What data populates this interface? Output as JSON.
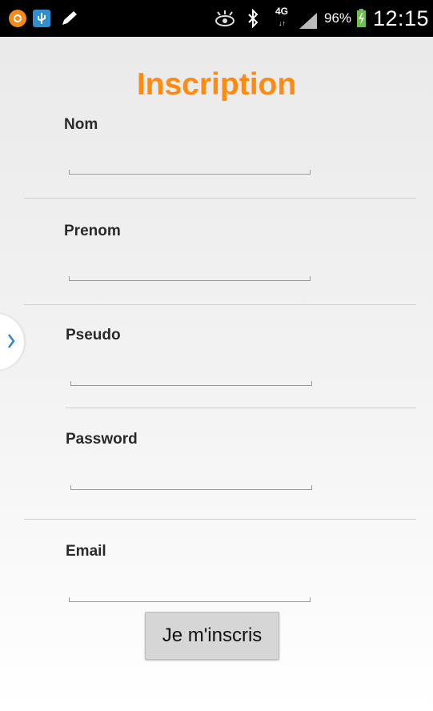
{
  "status_bar": {
    "network": "4G",
    "battery_percent": "96%",
    "time": "12:15",
    "icons": [
      "app-icon",
      "usb-icon",
      "pencil-icon",
      "eye-icon",
      "bluetooth-icon",
      "signal-icon",
      "battery-charging-icon"
    ]
  },
  "form": {
    "title": "Inscription",
    "fields": [
      {
        "label": "Nom",
        "value": ""
      },
      {
        "label": "Prenom",
        "value": ""
      },
      {
        "label": "Pseudo",
        "value": ""
      },
      {
        "label": "Password",
        "value": ""
      },
      {
        "label": "Email",
        "value": ""
      }
    ],
    "submit_label": "Je m'inscris"
  },
  "colors": {
    "title": "#ff8a10",
    "status_bar": "#000000",
    "battery": "#6cc24a"
  }
}
